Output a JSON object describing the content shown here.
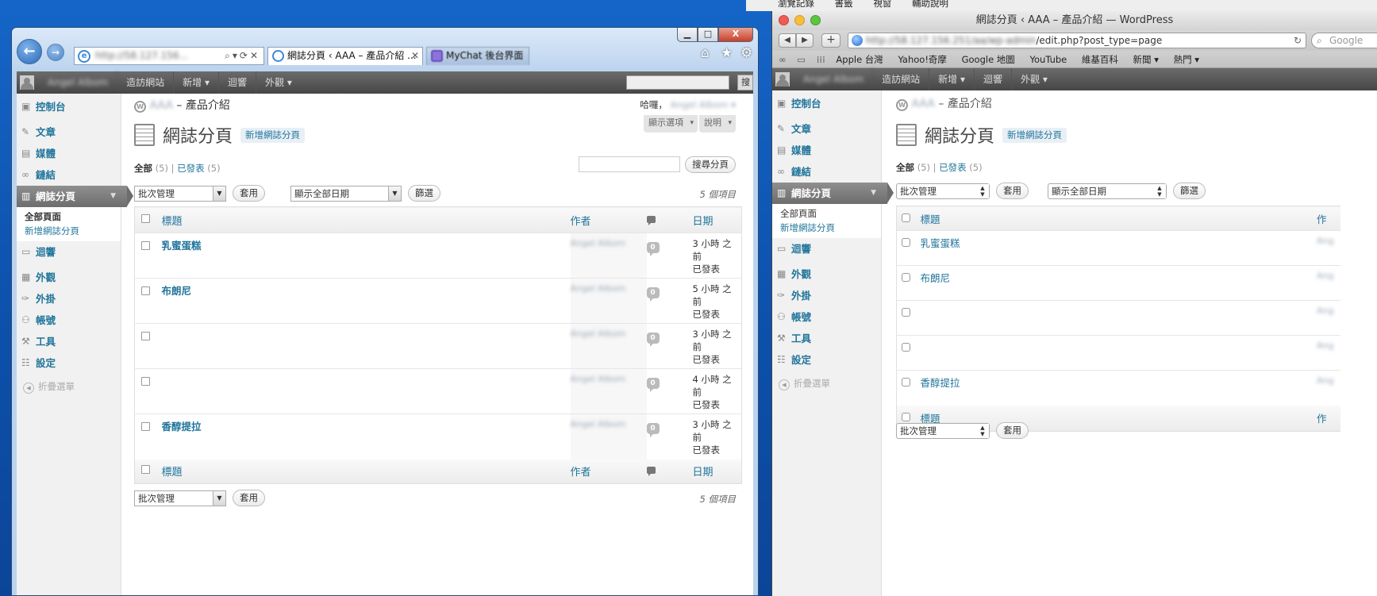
{
  "top_menu": [
    "瀏覽記錄",
    "書籤",
    "視窗",
    "輔助說明"
  ],
  "ie": {
    "window_buttons": [
      "▁",
      "□",
      "X"
    ],
    "address": "http://58.127.156...",
    "tabs": [
      {
        "label": "網誌分頁 ‹ AAA – 產品介紹 ...",
        "active": true
      },
      {
        "label": "MyChat 後台界面",
        "active": false
      }
    ],
    "admin_bar": {
      "user": "Angel Albom",
      "items": [
        "造訪網站",
        "新增 ▾",
        "迴響",
        "外觀 ▾"
      ],
      "search_btn": "搜"
    },
    "sidebar": {
      "items": [
        {
          "label": "控制台",
          "icon": "dashboard-icon"
        },
        {
          "label": "文章",
          "icon": "pin-icon"
        },
        {
          "label": "媒體",
          "icon": "media-icon"
        },
        {
          "label": "鏈結",
          "icon": "link-icon"
        },
        {
          "label": "網誌分頁",
          "icon": "pages-icon"
        },
        {
          "label": "迴響",
          "icon": "comments-icon"
        },
        {
          "label": "外觀",
          "icon": "appearance-icon"
        },
        {
          "label": "外掛",
          "icon": "plugins-icon"
        },
        {
          "label": "帳號",
          "icon": "users-icon"
        },
        {
          "label": "工具",
          "icon": "tools-icon"
        },
        {
          "label": "設定",
          "icon": "settings-icon"
        }
      ],
      "submenu": [
        "全部頁面",
        "新增網誌分頁"
      ],
      "collapse": "折疊選單"
    },
    "header": {
      "site": "AAA",
      "site_suffix": "– 產品介紹",
      "greeting": "哈囉，",
      "user": "Angel Albom ▾",
      "screen_options": "顯示選項",
      "help": "說明"
    },
    "page_title": "網誌分頁",
    "add_new": "新增網誌分頁",
    "filters": {
      "all": "全部",
      "all_count": "(5)",
      "sep": "|",
      "published": "已發表",
      "published_count": "(5)"
    },
    "search_button": "搜尋分頁",
    "bulk_select": "批次管理",
    "apply": "套用",
    "date_select": "顯示全部日期",
    "filter_btn": "篩選",
    "items_count": "5 個項目",
    "columns": {
      "title": "標題",
      "author": "作者",
      "date": "日期"
    },
    "rows": [
      {
        "title": "乳蜜蛋糕",
        "author": "Angel Albom",
        "comments": "0",
        "date1": "3 小時 之",
        "date2": "前",
        "status": "已發表"
      },
      {
        "title": "布朗尼",
        "author": "Angel Albom",
        "comments": "0",
        "date1": "5 小時 之",
        "date2": "前",
        "status": "已發表"
      },
      {
        "title": "",
        "author": "Angel Albom",
        "comments": "0",
        "date1": "3 小時 之",
        "date2": "前",
        "status": "已發表"
      },
      {
        "title": "",
        "author": "Angel Albom",
        "comments": "0",
        "date1": "4 小時 之",
        "date2": "前",
        "status": "已發表"
      },
      {
        "title": "香醇提拉",
        "author": "Angel Albom",
        "comments": "0",
        "date1": "3 小時 之",
        "date2": "前",
        "status": "已發表"
      }
    ]
  },
  "mac": {
    "window_title": "網誌分頁 ‹ AAA – 產品介紹 — WordPress",
    "url_blurred": "http://58.127.156.251/aa/wp-admin",
    "url_visible": "/edit.php?post_type=page",
    "search_placeholder": "Google",
    "bookmarks": [
      "Apple 台灣",
      "Yahoo!奇摩",
      "Google 地圖",
      "YouTube",
      "維基百科",
      "新聞 ▾",
      "熱門 ▾"
    ],
    "admin_bar": {
      "user": "Angel Albom",
      "items": [
        "造訪網站",
        "新增 ▾",
        "迴響",
        "外觀 ▾"
      ]
    },
    "sidebar_submenu": [
      "全部頁面",
      "新增網誌分頁"
    ],
    "collapse": "折疊選單",
    "site": "AAA",
    "site_suffix": "– 產品介紹",
    "page_title": "網誌分頁",
    "add_new": "新增網誌分頁",
    "filters": {
      "all": "全部",
      "all_count": "(5)",
      "sep": "|",
      "published": "已發表",
      "published_count": "(5)"
    },
    "bulk_select": "批次管理",
    "apply": "套用",
    "date_select": "顯示全部日期",
    "filter_btn": "篩選",
    "columns": {
      "title": "標題",
      "author": "作"
    },
    "rows": [
      {
        "title": "乳蜜蛋糕",
        "author": "Ang"
      },
      {
        "title": "布朗尼",
        "author": "Ang"
      },
      {
        "title": "",
        "author": "Ang"
      },
      {
        "title": "",
        "author": "Ang"
      },
      {
        "title": "香醇提拉",
        "author": "Ang"
      }
    ]
  }
}
